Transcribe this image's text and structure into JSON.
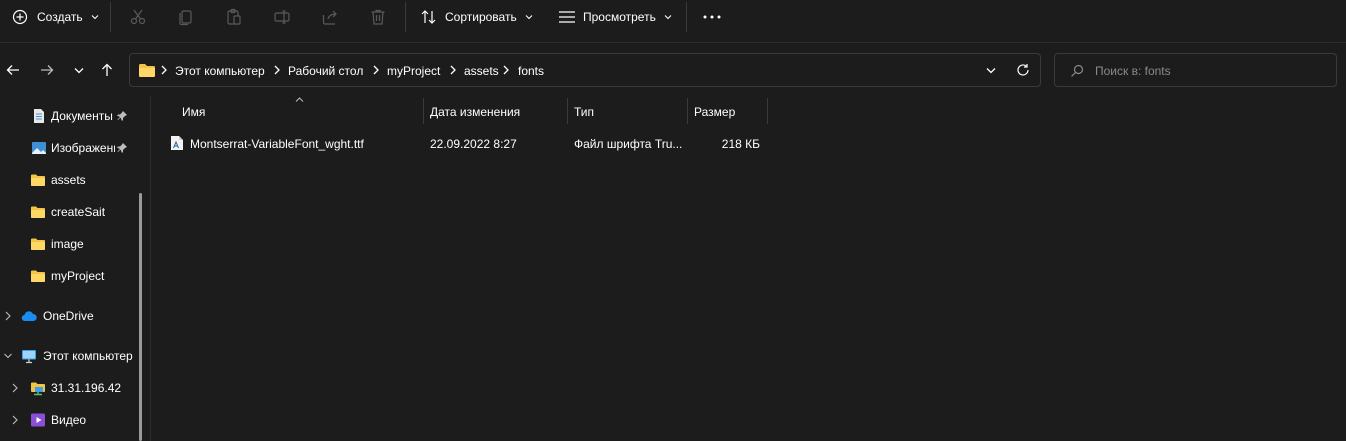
{
  "toolbar": {
    "create_label": "Создать",
    "sort_label": "Сортировать",
    "view_label": "Просмотреть",
    "icons": [
      "plus-circle-icon",
      "cut-icon",
      "copy-icon",
      "paste-icon",
      "rename-icon",
      "share-icon",
      "delete-icon",
      "sort-icon",
      "view-icon",
      "more-icon"
    ]
  },
  "navigation": {
    "icons": [
      "back-arrow-icon",
      "forward-arrow-icon",
      "recent-chevron-icon",
      "up-arrow-icon"
    ]
  },
  "address_bar": {
    "crumbs": [
      "Этот компьютер",
      "Рабочий стол",
      "myProject",
      "assets",
      "fonts"
    ]
  },
  "search": {
    "placeholder": "Поиск в: fonts"
  },
  "sidebar": {
    "items": [
      {
        "label": "Документы",
        "icon": "document-icon",
        "pinned": true
      },
      {
        "label": "Изображения",
        "icon": "pictures-icon",
        "pinned": true
      },
      {
        "label": "assets",
        "icon": "folder-icon"
      },
      {
        "label": "createSait",
        "icon": "folder-icon"
      },
      {
        "label": "image",
        "icon": "folder-icon"
      },
      {
        "label": "myProject",
        "icon": "folder-icon"
      },
      {
        "label": "OneDrive",
        "icon": "cloud-icon"
      },
      {
        "label": "Этот компьютер",
        "icon": "computer-icon"
      },
      {
        "label": "31.31.196.42",
        "icon": "network-drive-icon"
      },
      {
        "label": "Видео",
        "icon": "video-icon"
      }
    ]
  },
  "file_list": {
    "columns": [
      "Имя",
      "Дата изменения",
      "Тип",
      "Размер"
    ],
    "rows": [
      {
        "name": "Montserrat-VariableFont_wght.ttf",
        "modified": "22.09.2022 8:27",
        "type": "Файл шрифта Tru...",
        "size": "218 КБ"
      }
    ]
  },
  "colors": {
    "background": "#1c1c1c",
    "border": "#3a3a3a",
    "folder": "#f3c443",
    "accent": "#0078d4"
  }
}
